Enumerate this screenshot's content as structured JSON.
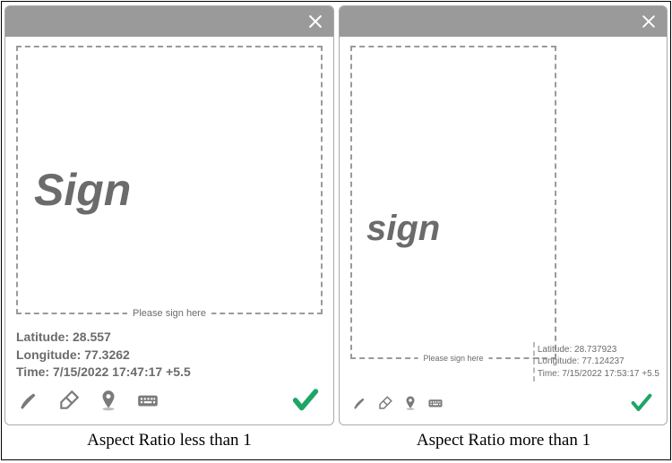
{
  "left": {
    "sign_placeholder": "Sign",
    "please_sign": "Please sign here",
    "latitude_label": "Latitude:",
    "latitude_value": "28.557",
    "longitude_label": "Longitude:",
    "longitude_value": "77.3262",
    "time_label": "Time:",
    "time_value": "7/15/2022 17:47:17 +5.5",
    "caption": "Aspect Ratio less than 1"
  },
  "right": {
    "sign_placeholder": "sign",
    "please_sign": "Please sign here",
    "latitude_label": "Latitude:",
    "latitude_value": "28.737923",
    "longitude_label": "Longitude:",
    "longitude_value": "77.124237",
    "time_label": "Time:",
    "time_value": "7/15/2022 17:53:17 +5.5",
    "caption": "Aspect Ratio more than 1"
  },
  "icons": {
    "brush": "brush-icon",
    "eraser": "eraser-icon",
    "location": "location-pin-icon",
    "keyboard": "keyboard-icon",
    "close": "close-icon",
    "confirm": "check-icon"
  }
}
